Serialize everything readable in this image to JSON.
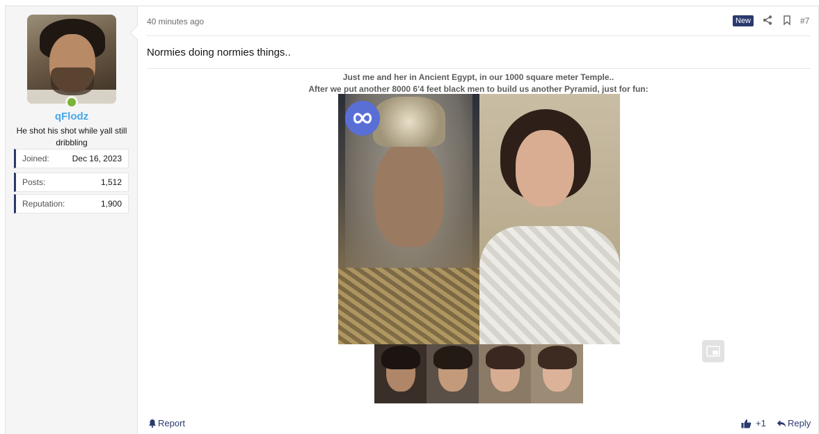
{
  "post": {
    "time": "40 minutes ago",
    "badge": "New",
    "number": "#7",
    "title": "Normies doing normies things..",
    "caption_line1": "Just me and her in Ancient Egypt, in our 1000 square meter Temple..",
    "caption_line2": "After we put another 8000 6'4 feet black men to build us another Pyramid, just for fun:",
    "report_label": "Report",
    "reaction_count": "+1",
    "reply_label": "Reply"
  },
  "user": {
    "name": "qFlodz",
    "title": "He shot his shot while yall still dribbling",
    "stats": [
      {
        "label": "Joined:",
        "value": "Dec 16, 2023"
      },
      {
        "label": "Posts:",
        "value": "1,512"
      },
      {
        "label": "Reputation:",
        "value": "1,900"
      }
    ],
    "online": true
  },
  "colors": {
    "accent": "#2b3a6e",
    "username": "#47a7eb",
    "online": "#7ab536"
  },
  "icons": [
    "share-icon",
    "bookmark-icon",
    "bell-icon",
    "thumbs-up-icon",
    "reply-icon",
    "picture-in-picture-icon"
  ]
}
